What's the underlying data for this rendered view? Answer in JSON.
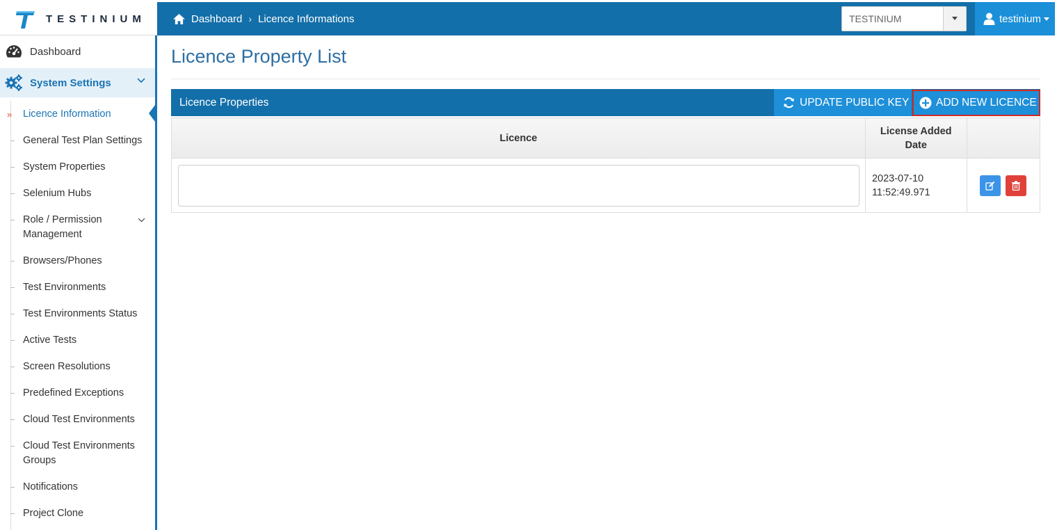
{
  "brand": {
    "logo_text": "TESTINIUM",
    "logo_color": "#1a86c7"
  },
  "topbar": {
    "breadcrumb": [
      "Dashboard",
      "Licence Informations"
    ],
    "project_select": {
      "value": "TESTINIUM"
    },
    "user": {
      "name": "testinium"
    },
    "colors": {
      "bar": "#136fa9",
      "user_button": "#1b8fd8"
    }
  },
  "sidebar": {
    "dashboard_label": "Dashboard",
    "section_label": "System Settings",
    "items": [
      {
        "label": "Licence Information",
        "active": true
      },
      {
        "label": "General Test Plan Settings"
      },
      {
        "label": "System Properties"
      },
      {
        "label": "Selenium Hubs"
      },
      {
        "label": "Role / Permission Management",
        "has_submenu": true
      },
      {
        "label": "Browsers/Phones"
      },
      {
        "label": "Test Environments"
      },
      {
        "label": "Test Environments Status"
      },
      {
        "label": "Active Tests"
      },
      {
        "label": "Screen Resolutions"
      },
      {
        "label": "Predefined Exceptions"
      },
      {
        "label": "Cloud Test Environments"
      },
      {
        "label": "Cloud Test Environments Groups"
      },
      {
        "label": "Notifications"
      },
      {
        "label": "Project Clone"
      }
    ]
  },
  "main": {
    "page_title": "Licence Property List",
    "panel": {
      "title": "Licence Properties",
      "update_button": "UPDATE PUBLIC KEY",
      "add_button": "ADD NEW LICENCE"
    },
    "table": {
      "columns": [
        "Licence",
        "License Added Date",
        ""
      ],
      "rows": [
        {
          "licence": "",
          "date_line1": "2023-07-10",
          "date_line2": "11:52:49.971"
        }
      ]
    }
  },
  "icons": [
    "home-icon",
    "user-icon",
    "dashboard-icon",
    "gears-icon",
    "chevron-down-icon",
    "refresh-icon",
    "plus-circle-icon",
    "edit-icon",
    "trash-icon"
  ]
}
